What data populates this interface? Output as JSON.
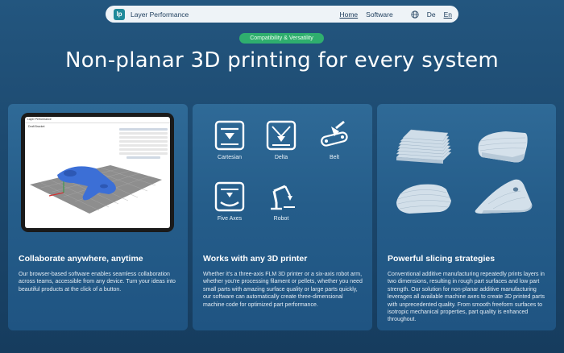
{
  "nav": {
    "brand": "Layer Performance",
    "logo_text": "lp",
    "links": [
      {
        "label": "Home",
        "active": true
      },
      {
        "label": "Software",
        "active": false
      }
    ],
    "languages": [
      {
        "label": "De",
        "active": false
      },
      {
        "label": "En",
        "active": true
      }
    ]
  },
  "hero": {
    "badge": "Compatibility & Versatility",
    "title": "Non-planar 3D printing for every system"
  },
  "cards": [
    {
      "title": "Collaborate anywhere, anytime",
      "text": "Our browser-based software enables seamless collaboration across teams, accessible from any device. Turn your ideas into beautiful products at the click of a button."
    },
    {
      "title": "Works with any 3D printer",
      "text": "Whether it's a three-axis FLM 3D printer or a six-axis robot arm, whether you're processing filament or pellets, whether you need small parts with amazing surface quality or large parts quickly, our software can automatically create three-dimensional machine code for optimized part performance."
    },
    {
      "title": "Powerful slicing strategies",
      "text": "Conventional additive manufacturing repeatedly prints layers in two dimensions, resulting in rough part surfaces and low part strength. Our solution for non-planar additive manufacturing leverages all available machine axes to create 3D printed parts with unprecedented quality. From smooth freeform surfaces to isotropic mechanical properties, part quality is enhanced throughout."
    }
  ],
  "tablet": {
    "app_title": "Layer Performance",
    "tab": "Draft Bracket"
  },
  "printers": [
    {
      "label": "Cartesian",
      "icon": "cartesian-icon"
    },
    {
      "label": "Delta",
      "icon": "delta-icon"
    },
    {
      "label": "Belt",
      "icon": "belt-icon"
    },
    {
      "label": "Five Axes",
      "icon": "five-axes-icon"
    },
    {
      "label": "Robot",
      "icon": "robot-icon"
    }
  ],
  "colors": {
    "background": "#1d4a70",
    "card": "#2a6390",
    "badge": "#2fae6e",
    "accent_icon": "#ffffff"
  }
}
